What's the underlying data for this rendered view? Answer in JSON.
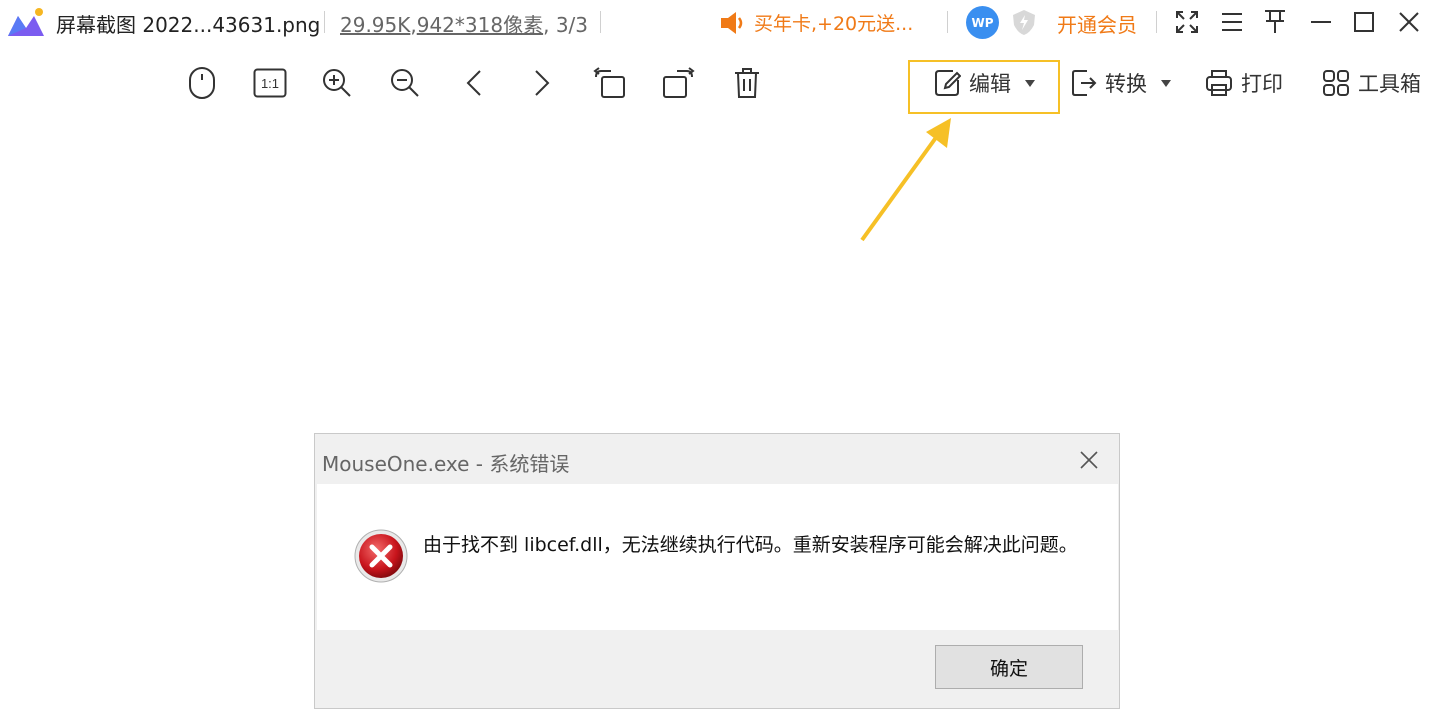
{
  "titlebar": {
    "file_name": "屏幕截图 2022...43631.png",
    "file_size": "29.95K",
    "dimensions": "942*318像素",
    "page_index": "3/3",
    "promo_text": "买年卡,+20元送...",
    "avatar_text": "WP",
    "vip_label": "开通会员",
    "accent_color": "#f07a17"
  },
  "toolbar": {
    "tools": [
      "mouse-icon",
      "actual-size-icon",
      "zoom-in-icon",
      "zoom-out-icon",
      "previous-icon",
      "next-icon",
      "rotate-left-icon",
      "rotate-right-icon",
      "delete-icon"
    ],
    "actual_size_label": "1:1",
    "edit_label": "编辑",
    "convert_label": "转换",
    "print_label": "打印",
    "toolbox_label": "工具箱",
    "highlight_color": "#f6c026"
  },
  "dialog": {
    "title": "MouseOne.exe - 系统错误",
    "message": "由于找不到 libcef.dll，无法继续执行代码。重新安装程序可能会解决此问题。",
    "ok_label": "确定"
  }
}
